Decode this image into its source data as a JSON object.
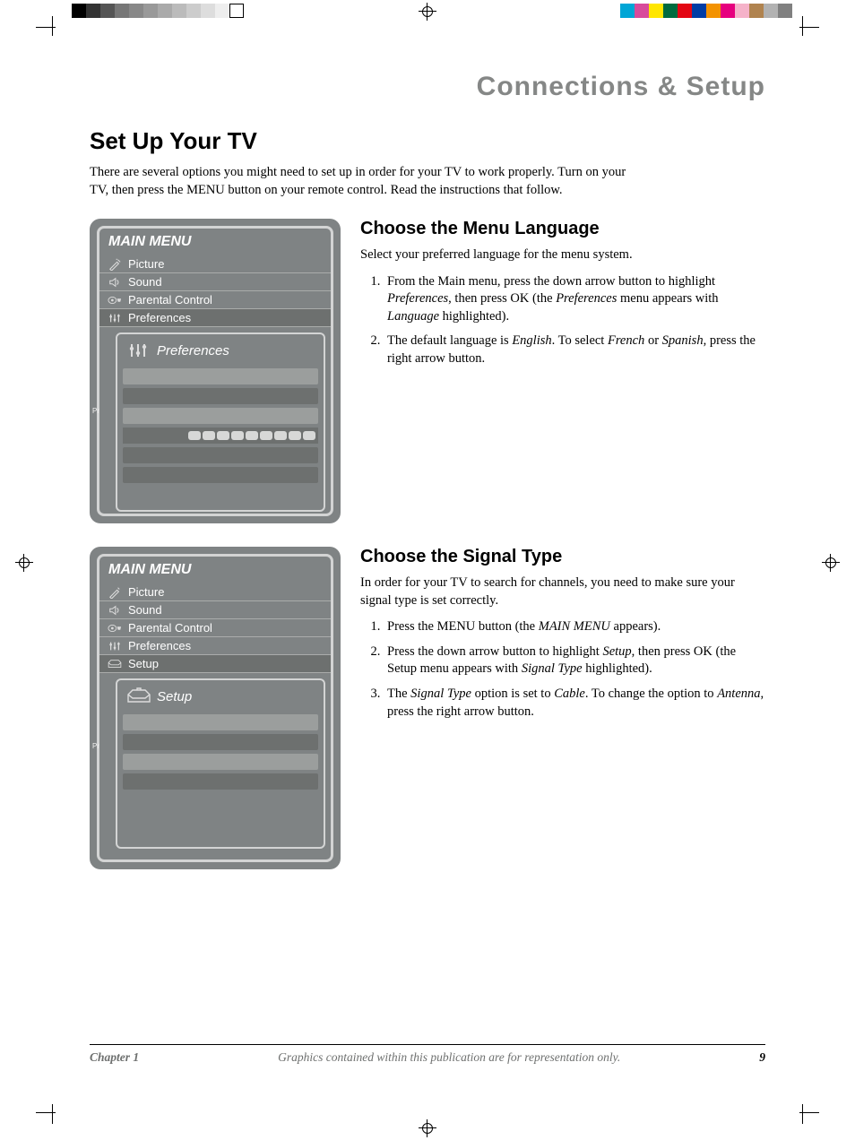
{
  "header": {
    "section_title": "Connections & Setup"
  },
  "title": "Set Up Your TV",
  "intro": "There are several options you might need to set up in order for your TV to work properly. Turn on your TV, then press the MENU button on your remote control. Read the instructions that follow.",
  "menu1": {
    "title": "MAIN MENU",
    "items": [
      "Picture",
      "Sound",
      "Parental Control",
      "Preferences"
    ],
    "highlight_index": 3,
    "submenu_title": "Preferences",
    "pr_label": "Pr"
  },
  "menu2": {
    "title": "MAIN MENU",
    "items": [
      "Picture",
      "Sound",
      "Parental Control",
      "Preferences",
      "Setup"
    ],
    "highlight_index": 4,
    "submenu_title": "Setup",
    "pr_label": "Pr"
  },
  "sec1": {
    "heading": "Choose the Menu Language",
    "lead": "Select your preferred language for the menu system.",
    "steps": [
      "From the Main menu, press the down arrow button to highlight <em>Preferences</em>, then press OK (the <em>Preferences</em> menu appears with <em>Language</em> highlighted).",
      "The default language is <em>English</em>. To select <em>French</em> or <em>Spanish</em>, press the right arrow button."
    ]
  },
  "sec2": {
    "heading": "Choose the Signal Type",
    "lead": "In order for your TV to search for channels, you need to make sure your signal type is set correctly.",
    "steps": [
      "Press the MENU button (the <em>MAIN MENU</em> appears).",
      "Press the down arrow button to highlight <em>Setup</em>, then press OK (the Setup menu appears with <em>Signal Type</em> highlighted).",
      "The <em>Signal Type</em> option is set to <em>Cable</em>. To change the option to <em>Antenna</em>, press the right arrow button."
    ]
  },
  "footer": {
    "chapter": "Chapter 1",
    "disclaimer": "Graphics contained within this publication are for representation only.",
    "page": "9"
  },
  "colorbar_left": [
    "#000",
    "#333",
    "#555",
    "#777",
    "#888",
    "#999",
    "#aaa",
    "#bbb",
    "#ccc",
    "#ddd",
    "#eee",
    "#fff"
  ],
  "colorbar_right": [
    "#00a6d6",
    "#d84b9b",
    "#ffe600",
    "#006b3f",
    "#e30613",
    "#003da5",
    "#f39200",
    "#e6007e",
    "#f5b2c9",
    "#b0834f",
    "#b2b2b2",
    "#808080"
  ]
}
